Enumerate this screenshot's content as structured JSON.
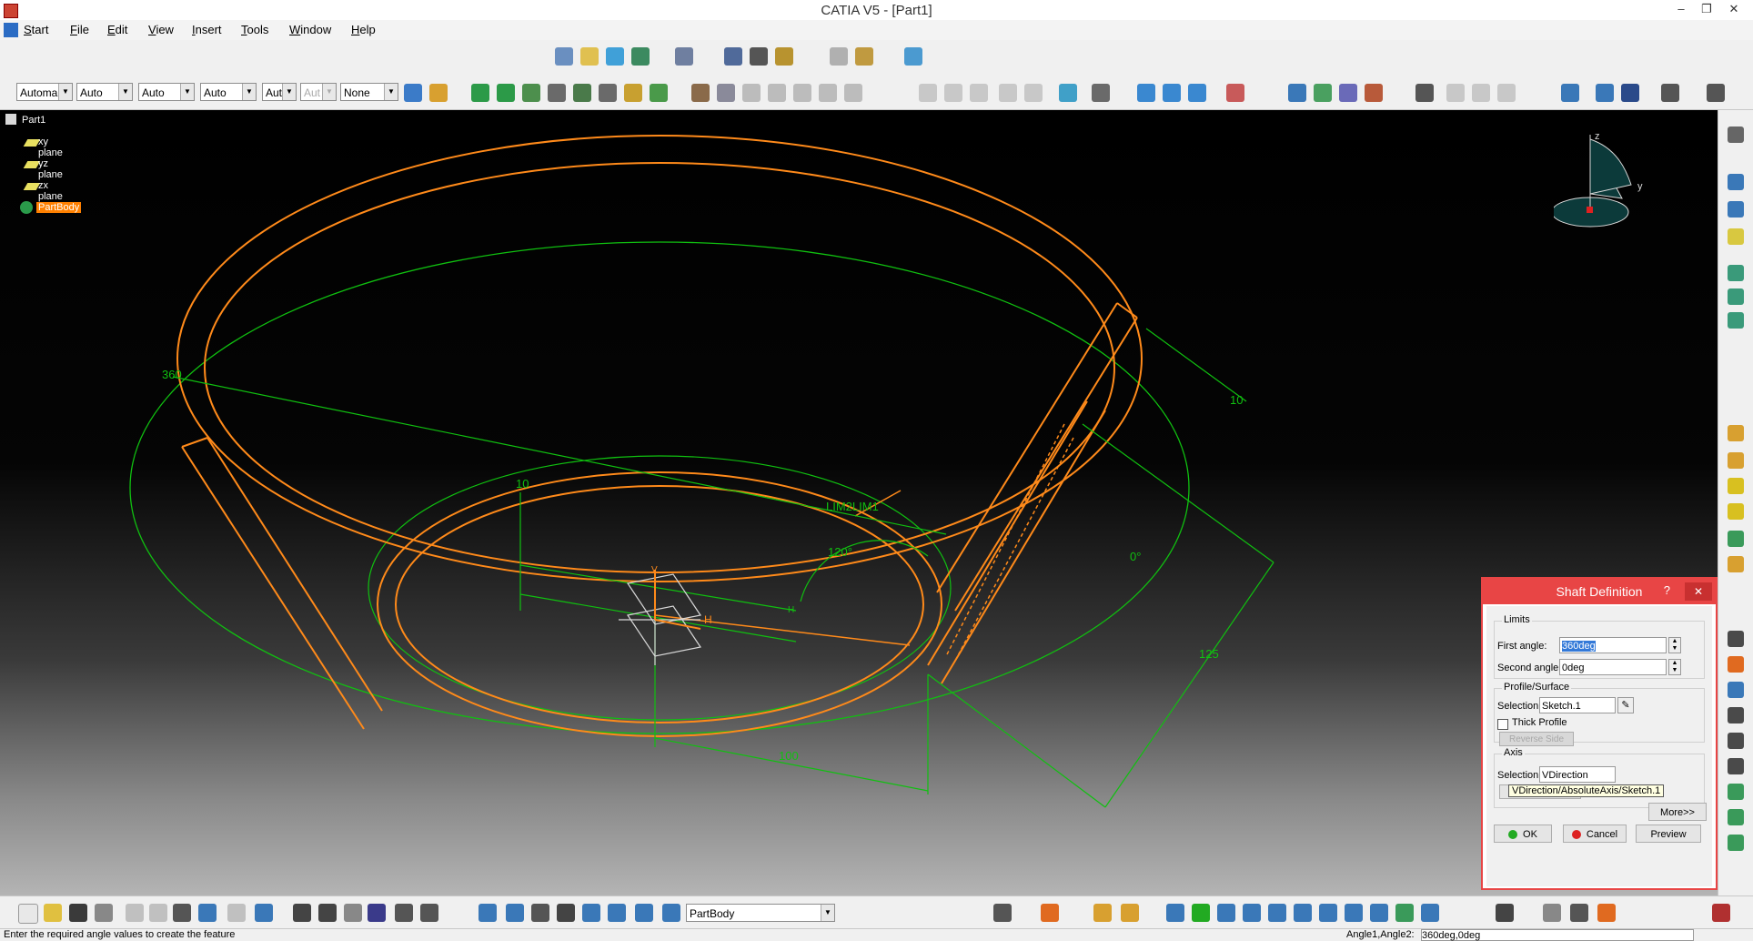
{
  "window": {
    "title": "CATIA V5 - [Part1]"
  },
  "menu": {
    "items": [
      "Start",
      "File",
      "Edit",
      "View",
      "Insert",
      "Tools",
      "Window",
      "Help"
    ]
  },
  "toolbar2": {
    "combos": [
      "Automa",
      "Auto",
      "Auto",
      "Auto",
      "Aut",
      "Aut",
      "None"
    ]
  },
  "tree": {
    "root": "Part1",
    "items": [
      "xy plane",
      "yz plane",
      "zx plane",
      "PartBody"
    ]
  },
  "viewport": {
    "dimensions": {
      "d360": "360",
      "d10a": "10",
      "d10b": "10",
      "d120": "120°",
      "d0": "0°",
      "d125": "125",
      "d100": "100",
      "lim": "LIM2LIM1",
      "h1": "H",
      "h2": "H",
      "v1": "V"
    },
    "axis_labels": {
      "z": "z",
      "y": "y"
    }
  },
  "dialog": {
    "title": "Shaft Definition",
    "help": "?",
    "close": "✕",
    "limits_group": "Limits",
    "first_angle_label": "First angle:",
    "first_angle_value": "360deg",
    "second_angle_label": "Second angle:",
    "second_angle_value": "0deg",
    "profile_group": "Profile/Surface",
    "profile_selection_label": "Selection:",
    "profile_selection_value": "Sketch.1",
    "thick_profile_label": "Thick Profile",
    "reverse_side_label": "Reverse Side",
    "axis_group": "Axis",
    "axis_selection_label": "Selection:",
    "axis_selection_value": "VDirection",
    "tooltip": "VDirection/AbsoluteAxis/Sketch.1",
    "more_label": "More>>",
    "ok_label": "OK",
    "cancel_label": "Cancel",
    "preview_label": "Preview"
  },
  "bottom_toolbar": {
    "body_combo": "PartBody"
  },
  "status": {
    "message": "Enter the required angle values to create the feature",
    "right_label": "Angle1,Angle2:",
    "right_value": "360deg,0deg"
  },
  "colors": {
    "accent": "#e84545",
    "highlight": "#ff8000",
    "sketch": "#00c800"
  }
}
